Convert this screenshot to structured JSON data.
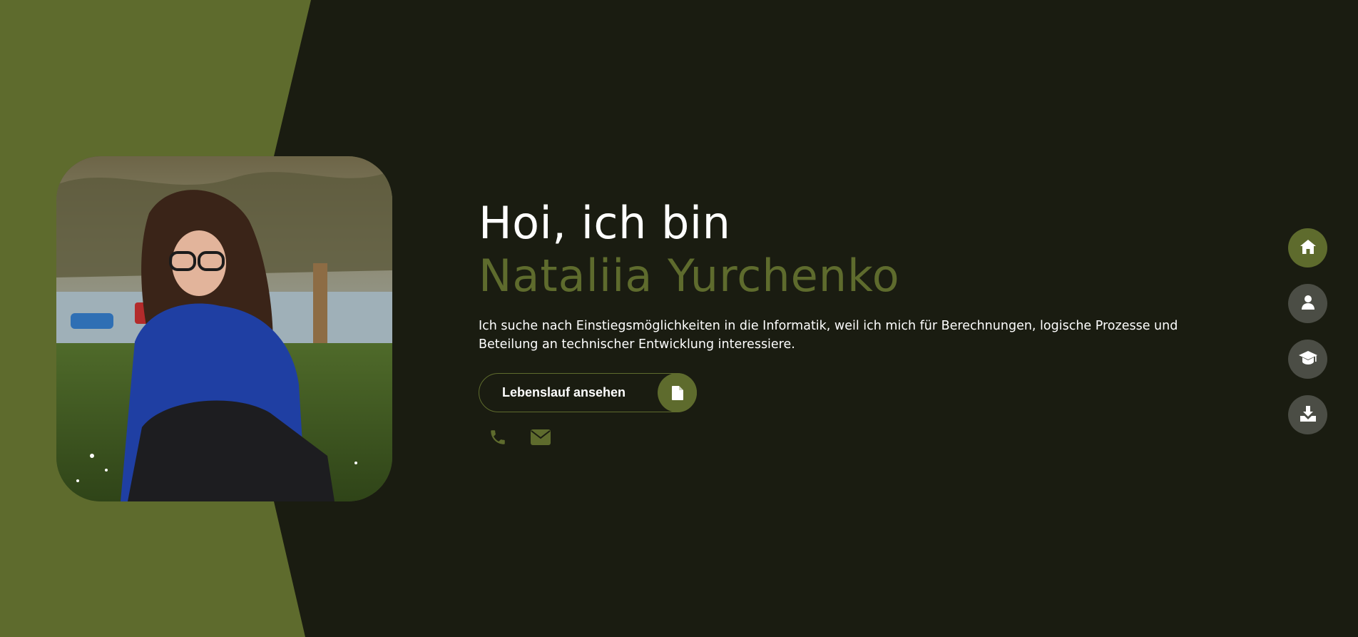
{
  "hero": {
    "greeting": "Hoi, ich bin",
    "name": "Nataliia Yurchenko",
    "intro": "Ich suche nach Einstiegsmöglichkeiten in die Informatik, weil ich mich für Berechnungen, logische Prozesse und Beteilung an technischer Entwicklung interessiere.",
    "cv_button_label": "Lebenslauf ansehen",
    "cv_button_icon": "file-icon",
    "contact_icons": [
      "phone-icon",
      "envelope-icon"
    ]
  },
  "side_nav": {
    "items": [
      {
        "icon": "home-icon",
        "active": true
      },
      {
        "icon": "user-icon",
        "active": false
      },
      {
        "icon": "graduation-cap-icon",
        "active": false
      },
      {
        "icon": "download-icon",
        "active": false
      }
    ]
  },
  "colors": {
    "background": "#1a1c11",
    "accent": "#5e6b2d",
    "text": "#ffffff",
    "nav_inactive": "#4b4d45"
  }
}
